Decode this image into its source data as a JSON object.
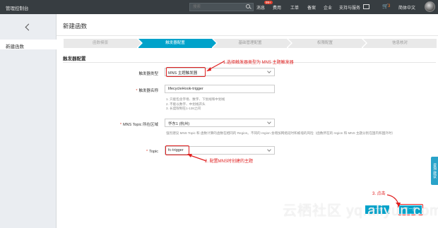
{
  "topbar": {
    "brand": "管理控制台",
    "search_placeholder": "搜索",
    "nav": [
      "消息",
      "费用",
      "工单",
      "备案",
      "企业",
      "支持与服务"
    ],
    "message_badge": "99+",
    "cart_count": "3",
    "language": "简体中文"
  },
  "sidebar": {
    "items": [
      {
        "label": "新建函数"
      }
    ]
  },
  "main": {
    "title": "新建函数",
    "steps": [
      {
        "label": "函数模版",
        "state": "done"
      },
      {
        "label": "触发器配置",
        "state": "active"
      },
      {
        "label": "基础管理配置",
        "state": "pending"
      },
      {
        "label": "权限配置",
        "state": "pending"
      },
      {
        "label": "信息核对",
        "state": "pending"
      }
    ],
    "section_title": "触发器配置",
    "form": {
      "trigger_type": {
        "label": "触发器类型",
        "value": "MNS 主题触发器"
      },
      "trigger_name": {
        "label": "触发器名称",
        "value": "lifecycleHook-trigger",
        "help": [
          "1. 只能包含字母、数字、下划线和中划线",
          "2. 不能以数字、中划线开头",
          "3. 长度限制在1-128之间"
        ]
      },
      "mns_region": {
        "label": "MNS Topic 所在区域",
        "value": "华东1 (杭州)",
        "help": "强烈建议 MNS Topic 和 函数计算的函数在相同的 Region。不同的 region 会增加网络延时和被墙的风险（函数所在的 region 和 MNS 主题分别在国内和国外时）"
      },
      "topic": {
        "label": "Topic",
        "value": "fc-trigger"
      }
    },
    "annotations": {
      "step1": "1.选择触发器类型为 MNS 主题触发器",
      "step2": "2. 配置MNS时创建的主题",
      "step3": "3. 点击"
    },
    "buttons": {
      "prev": "上一步",
      "next": "下一步"
    },
    "watermark": "云栖社区 yq.aliyun.com"
  },
  "float_tab": "咨询·建议",
  "colors": {
    "topbar": "#373d41",
    "accent": "#00a2ca",
    "annotation": "#e02020"
  }
}
